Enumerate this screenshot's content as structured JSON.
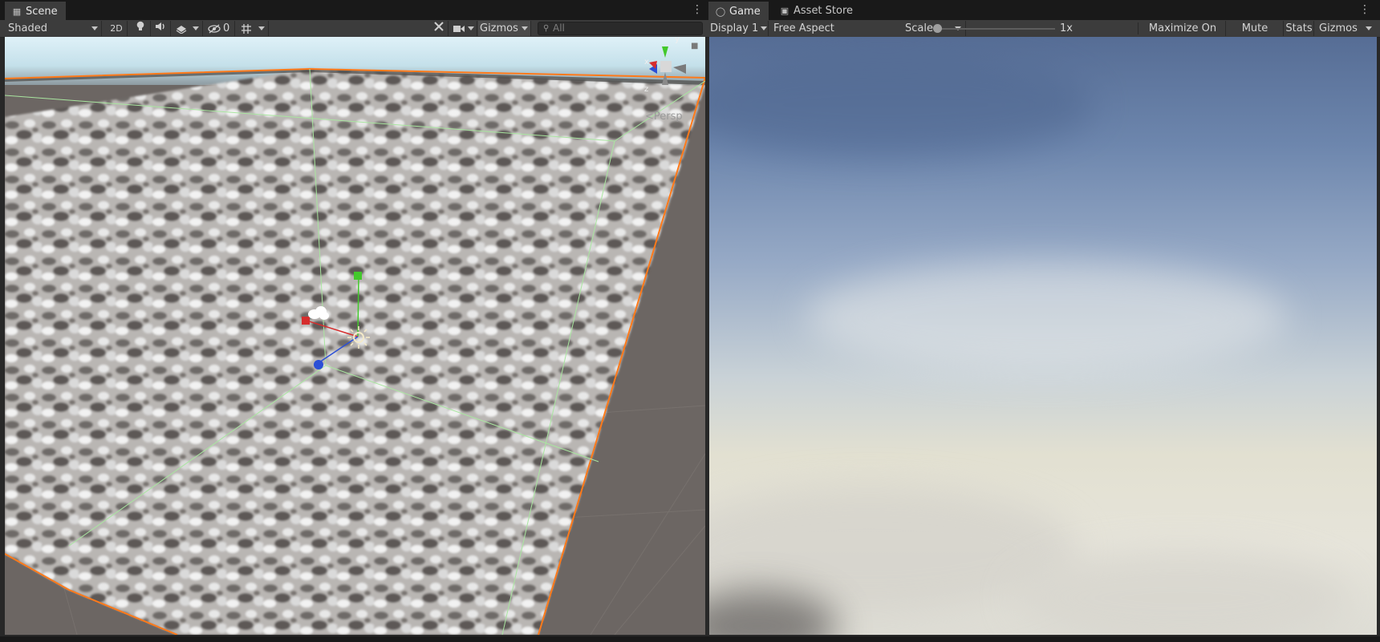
{
  "scene": {
    "tab_label": "Scene",
    "shading_mode": "Shaded",
    "toggle_2d": "2D",
    "hidden_count": "0",
    "gizmos_label": "Gizmos",
    "search_placeholder": "All",
    "projection_label": "Persp",
    "axis_labels": {
      "y": "y",
      "z": "z",
      "x": "x"
    }
  },
  "game": {
    "tab_label": "Game",
    "asset_store_tab_label": "Asset Store",
    "display": "Display 1",
    "aspect": "Free Aspect",
    "scale_label": "Scale",
    "scale_value": "1x",
    "scale_fraction": 0.0,
    "maximize_on_play": "Maximize On Play",
    "mute_audio": "Mute Audio",
    "stats": "Stats",
    "gizmos_label": "Gizmos"
  },
  "colors": {
    "selection_outline": "#ff7a1a",
    "bounds_lines": "#a9e6a0",
    "axis_x": "#d62d2d",
    "axis_y": "#42c82b",
    "axis_z": "#2b4fd6"
  },
  "icons": [
    "scene-grid-icon",
    "game-controller-icon",
    "lock-icon",
    "more-icon",
    "lightbulb-icon",
    "audio-icon",
    "effects-icon",
    "visibility-icon",
    "grid-icon",
    "tools-icon",
    "camera-icon",
    "search-icon",
    "cloud-icon",
    "sun-icon"
  ]
}
